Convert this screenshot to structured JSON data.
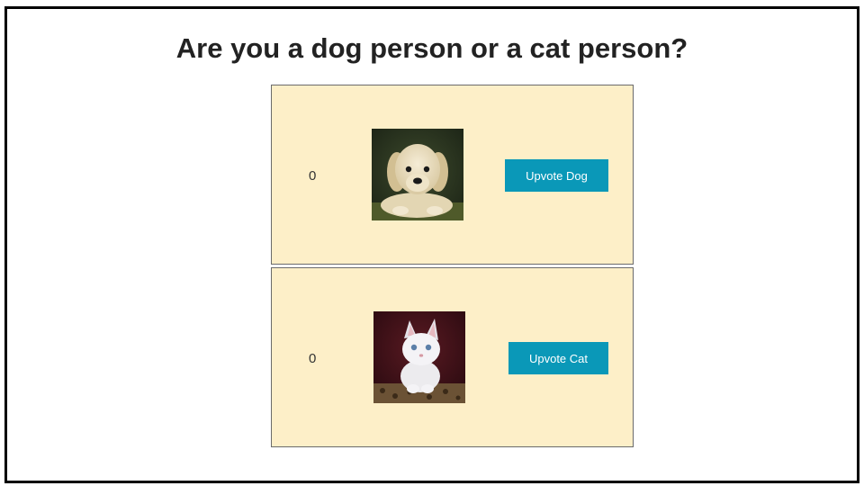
{
  "page": {
    "title": "Are you a dog person or a cat person?"
  },
  "dog": {
    "count": "0",
    "image_icon": "golden-retriever-puppy-photo",
    "button_label": "Upvote Dog"
  },
  "cat": {
    "count": "0",
    "image_icon": "white-kitten-photo",
    "button_label": "Upvote Cat"
  },
  "colors": {
    "card_background": "#fdefc8",
    "button_background": "#0a98b8",
    "button_text": "#ffffff"
  }
}
